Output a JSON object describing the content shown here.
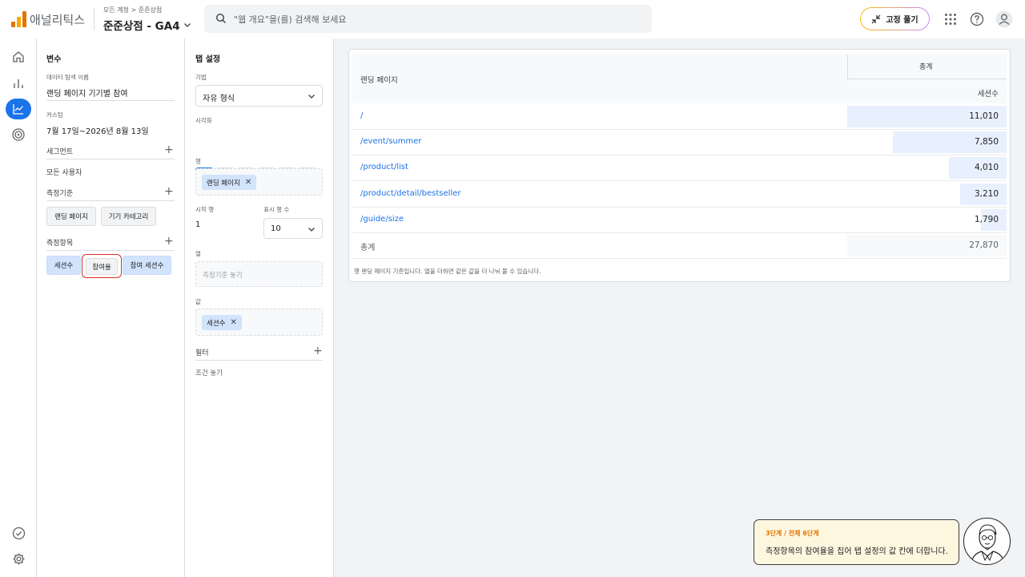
{
  "header": {
    "app_name": "애널리틱스",
    "breadcrumb": "모든 계정 > 준준상점",
    "property": "준준상점 - GA4",
    "search_placeholder": "\"웹 개요\"을(를) 검색해 보세요",
    "pin_button": "고정 풀기"
  },
  "variables": {
    "title": "변수",
    "exploration_name_label": "데이터 탐색 이름",
    "exploration_name": "랜딩 페이지 기기별 참여",
    "custom_label": "커스텀",
    "date_range": "7월 17일~2026년 8월 13일",
    "segments_label": "세그먼트",
    "segment_value": "모든 사용자",
    "dimensions_label": "측정기준",
    "dimensions": [
      "랜딩 페이지",
      "기기 카테고리"
    ],
    "metrics_label": "측정항목",
    "metrics": [
      "세션수",
      "참여율",
      "참여 세션수"
    ]
  },
  "tab_settings": {
    "title": "탭 설정",
    "technique_label": "기법",
    "technique_value": "자유 형식",
    "viz_label": "시각화",
    "rows_label": "행",
    "rows_chip": "랜딩 페이지",
    "start_row_label": "시작 행",
    "start_row_value": "1",
    "show_rows_label": "표시 행 수",
    "show_rows_value": "10",
    "columns_label": "열",
    "columns_placeholder": "측정기준 놓기",
    "values_label": "값",
    "values_chip": "세션수",
    "filters_label": "필터",
    "filters_placeholder": "조건 놓기"
  },
  "table": {
    "dimension_header": "랜딩 페이지",
    "total_header": "총계",
    "metric_header": "세션수",
    "rows": [
      {
        "page": "/",
        "sessions": "11,010",
        "value": 11010
      },
      {
        "page": "/event/summer",
        "sessions": "7,850",
        "value": 7850
      },
      {
        "page": "/product/list",
        "sessions": "4,010",
        "value": 4010
      },
      {
        "page": "/product/detail/bestseller",
        "sessions": "3,210",
        "value": 3210
      },
      {
        "page": "/guide/size",
        "sessions": "1,790",
        "value": 1790
      }
    ],
    "total_label": "총계",
    "total_value": "27,870",
    "footnote": "행 랜딩 페이지 기준입니다. 열을 더하면 같은 값을 더 나눠 볼 수 있습니다."
  },
  "guide": {
    "step": "3단계 / 전체 6단계",
    "message": "측정항목의 참여율을 집어 탭 설정의 값 칸에 더합니다."
  },
  "colors": {
    "accent": "#1a73e8",
    "highlight": "#d93025",
    "guide_step": "#e37400"
  }
}
